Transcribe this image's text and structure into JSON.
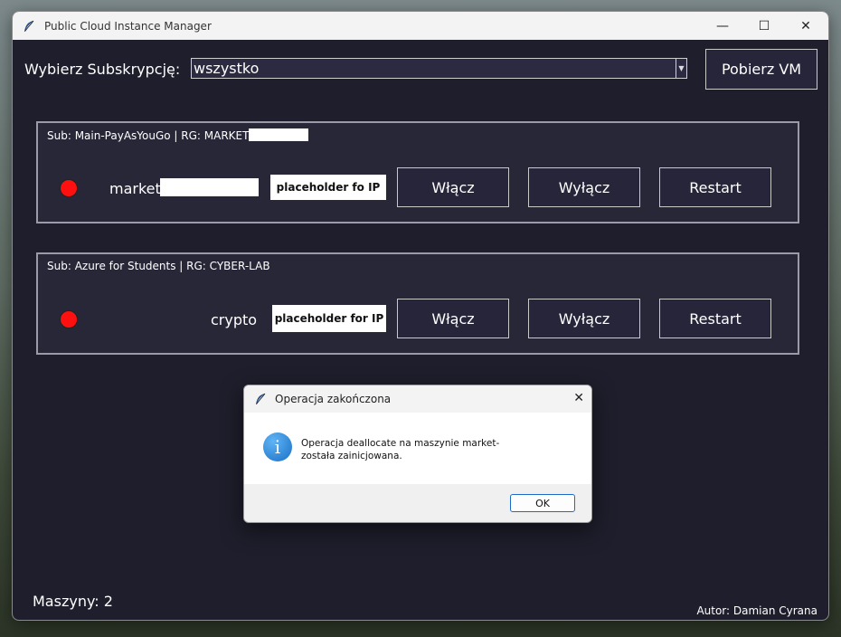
{
  "window": {
    "title": "Public Cloud Instance Manager",
    "controls": {
      "minimize": "—",
      "maximize": "☐",
      "close": "✕"
    }
  },
  "toolbar": {
    "subscription_label": "Wybierz Subskrypcję:",
    "subscription_value": "wszystko",
    "fetch_button": "Pobierz VM"
  },
  "vms": [
    {
      "header": "Sub: Main-PayAsYouGo  |  RG: MARKET",
      "name": "market-",
      "ip": "placeholder fo IP",
      "status_color": "#ff1010",
      "buttons": {
        "start": "Włącz",
        "stop": "Wyłącz",
        "restart": "Restart"
      }
    },
    {
      "header": "Sub: Azure for Students  |  RG: CYBER-LAB",
      "name": "crypto",
      "ip": "placeholder for IP",
      "status_color": "#ff1010",
      "buttons": {
        "start": "Włącz",
        "stop": "Wyłącz",
        "restart": "Restart"
      }
    }
  ],
  "footer": {
    "machines": "Maszyny: 2",
    "author": "Autor: Damian Cyrana"
  },
  "dialog": {
    "title": "Operacja zakończona",
    "message_line1": "Operacja deallocate na maszynie market-",
    "message_line2": "została zainicjowana.",
    "ok": "OK",
    "close": "✕",
    "icon": "info-icon"
  },
  "colors": {
    "window_bg": "#1e1e2c",
    "card_bg": "#282738",
    "status_off": "#ff1010",
    "accent": "#1b6ac9"
  }
}
